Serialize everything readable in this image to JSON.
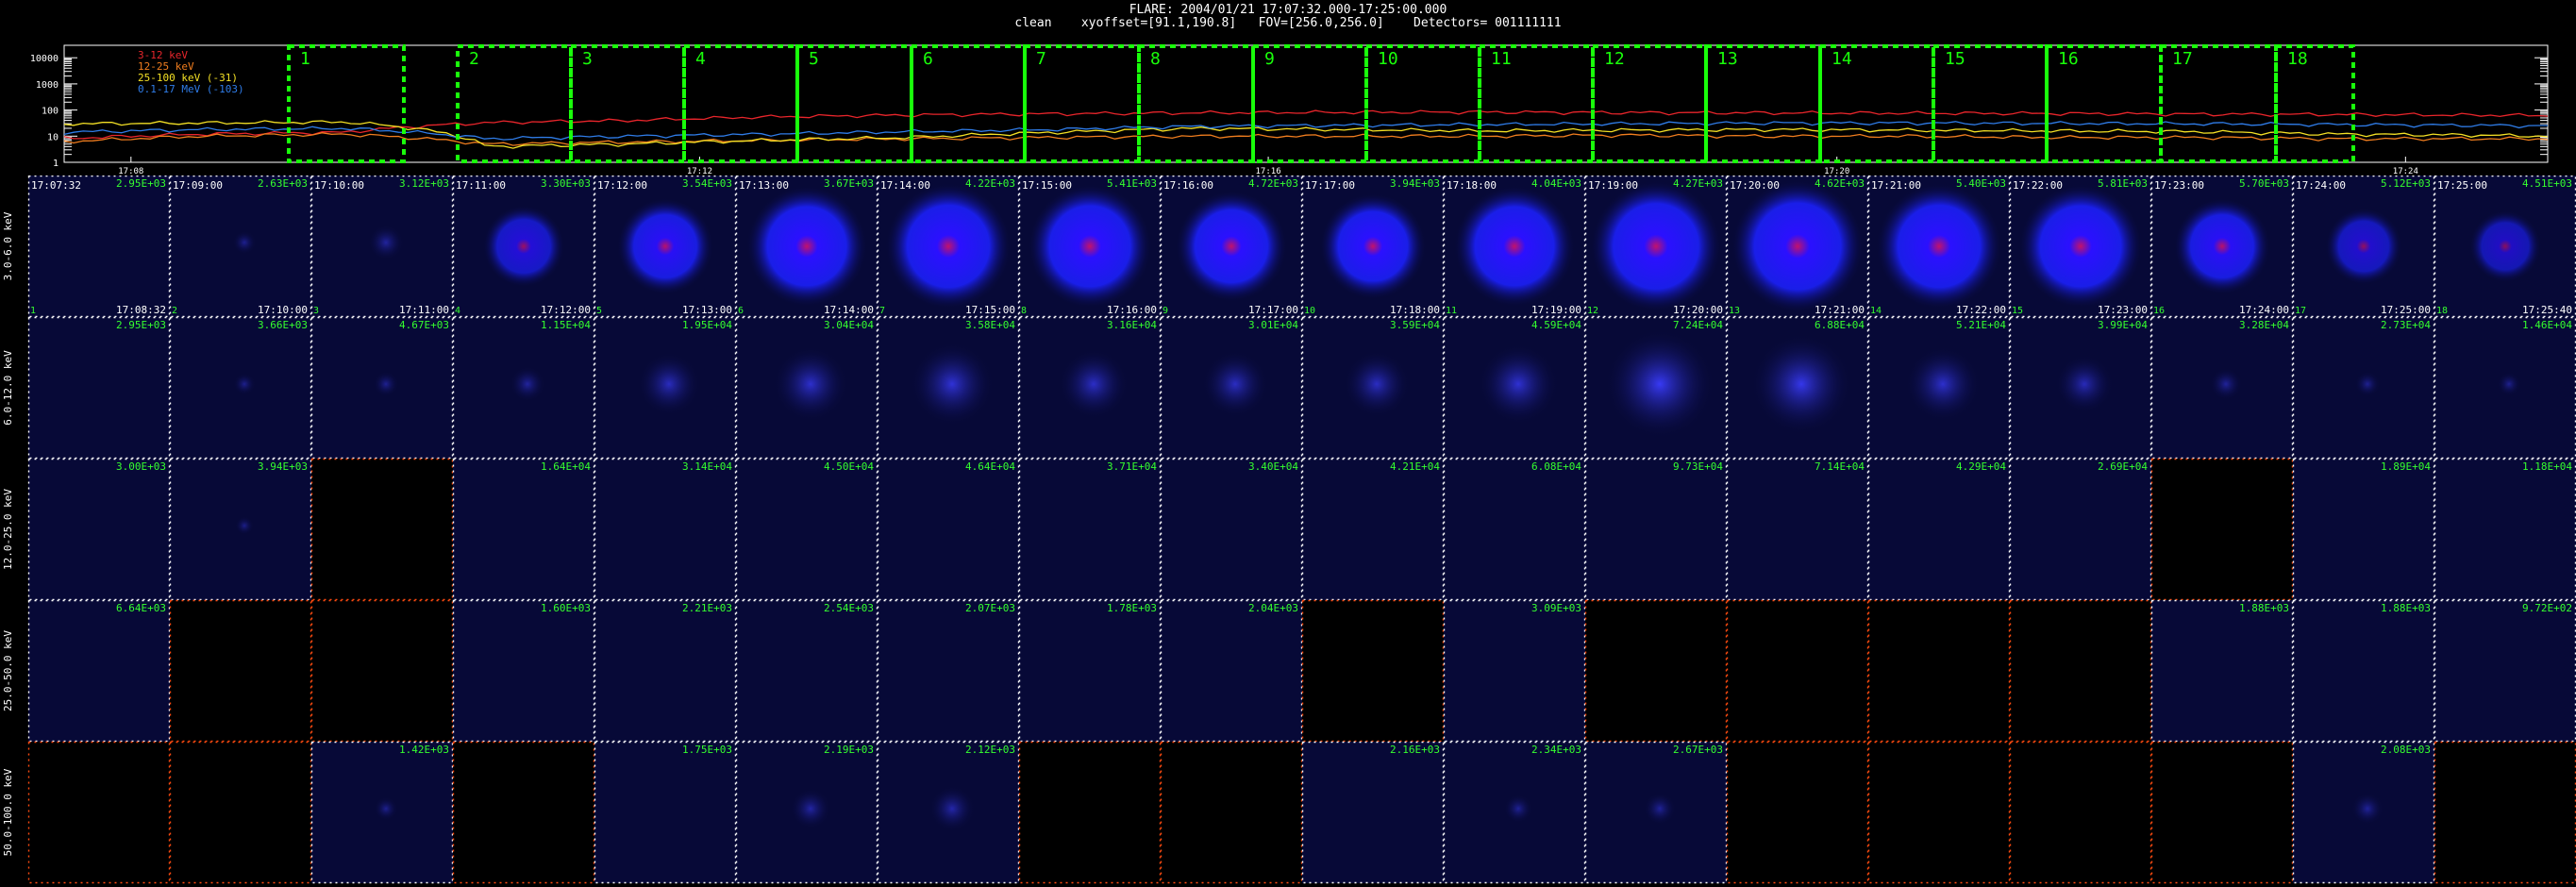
{
  "header": {
    "line1": "FLARE: 2004/01/21 17:07:32.000-17:25:00.000",
    "line2": "clean    xyoffset=[91.1,190.8]   FOV=[256.0,256.0]    Detectors= 001111111"
  },
  "chart_data": [
    {
      "type": "line",
      "title": "",
      "yscale": "log",
      "ylim": [
        1,
        30000
      ],
      "ytick_labels": [
        "1",
        "10",
        "100",
        "1000",
        "10000"
      ],
      "xlim_minutes": [
        7.53,
        25.0
      ],
      "xtick_labels": [
        "17:08",
        "17:12",
        "17:16",
        "17:20",
        "17:24"
      ],
      "legend": [
        {
          "name": "3-12 keV",
          "color": "#e8252b"
        },
        {
          "name": "12-25 keV",
          "color": "#f07d1e"
        },
        {
          "name": "25-100 keV (-31)",
          "color": "#f3e025"
        },
        {
          "name": "0.1-17 MeV (-103)",
          "color": "#2f7ce8"
        }
      ],
      "series": [
        {
          "name": "3-12 keV",
          "color": "#e8252b",
          "x": [
            7.5,
            8.5,
            9.5,
            10.5,
            11.5,
            12.5,
            13.5,
            14.5,
            15.5,
            16.5,
            17.5,
            18.5,
            19.5,
            20.5,
            21.5,
            22.5,
            23.5,
            24.5,
            25.0
          ],
          "y": [
            8,
            12,
            14,
            33,
            40,
            55,
            65,
            72,
            78,
            82,
            84,
            80,
            78,
            76,
            74,
            70,
            68,
            64,
            62
          ]
        },
        {
          "name": "12-25 keV",
          "color": "#f07d1e",
          "x": [
            7.5,
            8.5,
            9.5,
            10.5,
            11.5,
            12.5,
            13.5,
            14.5,
            15.5,
            16.5,
            17.5,
            18.5,
            19.5,
            20.5,
            21.5,
            22.5,
            23.5,
            24.5,
            25.0
          ],
          "y": [
            6,
            10,
            12,
            5,
            6,
            7,
            8,
            9,
            10,
            10,
            10,
            11,
            10,
            10,
            9,
            9,
            8,
            8,
            8
          ]
        },
        {
          "name": "25-100 keV (-31)",
          "color": "#f3e025",
          "x": [
            7.5,
            8.5,
            9.5,
            10.5,
            11.5,
            12.5,
            13.5,
            14.5,
            15.5,
            16.5,
            17.5,
            18.5,
            19.5,
            20.5,
            21.5,
            22.5,
            23.5,
            24.5,
            25.0
          ],
          "y": [
            30,
            32,
            35,
            4,
            5,
            7,
            9,
            14,
            20,
            18,
            16,
            17,
            18,
            17,
            16,
            15,
            12,
            11,
            10
          ]
        },
        {
          "name": "0.1-17 MeV (-103)",
          "color": "#2f7ce8",
          "x": [
            7.5,
            8.5,
            9.5,
            10.5,
            11.5,
            12.5,
            13.5,
            14.5,
            15.5,
            16.5,
            17.5,
            18.5,
            19.5,
            20.5,
            21.5,
            22.5,
            23.5,
            24.5,
            25.0
          ],
          "y": [
            14,
            18,
            20,
            8,
            10,
            12,
            15,
            18,
            24,
            26,
            28,
            30,
            32,
            32,
            31,
            30,
            28,
            26,
            25
          ]
        }
      ],
      "intervals": [
        "1",
        "2",
        "3",
        "4",
        "5",
        "6",
        "7",
        "8",
        "9",
        "10",
        "11",
        "12",
        "13",
        "14",
        "15",
        "16",
        "17",
        "18"
      ],
      "interval_bounds_minutes": [
        [
          9.17,
          11.17
        ],
        [
          12.13,
          14.0
        ],
        [
          14.0,
          15.9
        ],
        [
          15.9,
          17.87
        ],
        [
          17.87,
          19.87
        ],
        [
          19.87,
          21.87
        ],
        [
          21.87,
          23.87
        ],
        [
          23.87,
          25.87
        ],
        [
          25.87,
          27.87
        ],
        [
          27.87,
          29.87
        ],
        [
          29.87,
          31.87
        ],
        [
          31.87,
          33.87
        ],
        [
          33.87,
          35.87
        ],
        [
          35.87,
          37.87
        ],
        [
          37.87,
          39.87
        ],
        [
          39.87,
          41.87
        ],
        [
          41.87,
          43.87
        ],
        [
          43.87,
          45.2
        ]
      ]
    },
    {
      "type": "heatmap",
      "title": "",
      "row_labels": [
        "3.0-6.0 keV",
        "6.0-12.0 keV",
        "12.0-25.0 keV",
        "25.0-50.0 keV",
        "50.0-100.0 keV"
      ],
      "start_times": [
        "17:07:32",
        "17:09:00",
        "17:10:00",
        "17:11:00",
        "17:12:00",
        "17:13:00",
        "17:14:00",
        "17:15:00",
        "17:16:00",
        "17:17:00",
        "17:18:00",
        "17:19:00",
        "17:20:00",
        "17:21:00",
        "17:22:00",
        "17:23:00",
        "17:24:00",
        "17:25:00"
      ],
      "end_times": [
        "17:08:32",
        "17:10:00",
        "17:11:00",
        "17:12:00",
        "17:13:00",
        "17:14:00",
        "17:15:00",
        "17:16:00",
        "17:17:00",
        "17:18:00",
        "17:19:00",
        "17:20:00",
        "17:21:00",
        "17:22:00",
        "17:23:00",
        "17:24:00",
        "17:25:00",
        "17:25:40"
      ],
      "panel_numbers": [
        "1",
        "2",
        "3",
        "4",
        "5",
        "6",
        "7",
        "8",
        "9",
        "10",
        "11",
        "12",
        "13",
        "14",
        "15",
        "16",
        "17",
        "18"
      ],
      "max_labels": [
        [
          "2.95E+03",
          "2.63E+03",
          "3.12E+03",
          "3.30E+03",
          "3.54E+03",
          "3.67E+03",
          "4.22E+03",
          "5.41E+03",
          "4.72E+03",
          "3.94E+03",
          "4.04E+03",
          "4.27E+03",
          "4.62E+03",
          "5.40E+03",
          "5.81E+03",
          "5.70E+03",
          "5.12E+03",
          "4.51E+03"
        ],
        [
          "2.95E+03",
          "3.66E+03",
          "4.67E+03",
          "1.15E+04",
          "1.95E+04",
          "3.04E+04",
          "3.58E+04",
          "3.16E+04",
          "3.01E+04",
          "3.59E+04",
          "4.59E+04",
          "7.24E+04",
          "6.88E+04",
          "5.21E+04",
          "3.99E+04",
          "3.28E+04",
          "2.73E+04",
          "1.46E+04"
        ],
        [
          "3.00E+03",
          "3.94E+03",
          "",
          "1.64E+04",
          "3.14E+04",
          "4.50E+04",
          "4.64E+04",
          "3.71E+04",
          "3.40E+04",
          "4.21E+04",
          "6.08E+04",
          "9.73E+04",
          "7.14E+04",
          "4.29E+04",
          "2.69E+04",
          "",
          "1.89E+04",
          "1.18E+04"
        ],
        [
          "6.64E+03",
          "",
          "",
          "1.60E+03",
          "2.21E+03",
          "2.54E+03",
          "2.07E+03",
          "1.78E+03",
          "2.04E+03",
          "",
          "3.09E+03",
          "",
          "",
          "",
          "",
          "1.88E+03",
          "1.88E+03",
          "9.72E+02"
        ],
        [
          "",
          "",
          "1.42E+03",
          "",
          "1.75E+03",
          "2.19E+03",
          "2.12E+03",
          "",
          "",
          "2.16E+03",
          "2.34E+03",
          "2.67E+03",
          "",
          "",
          "",
          "",
          "2.08E+03",
          ""
        ]
      ],
      "black_panels": [
        [],
        [],
        [
          2,
          15
        ],
        [
          1,
          2,
          9,
          11,
          12,
          13,
          14
        ],
        [
          0,
          1,
          3,
          7,
          8,
          12,
          13,
          14,
          15,
          17
        ]
      ],
      "blob_intensity": [
        [
          0,
          0.05,
          0.12,
          0.45,
          0.6,
          0.85,
          0.9,
          0.88,
          0.75,
          0.7,
          0.85,
          0.95,
          0.97,
          0.9,
          0.88,
          0.6,
          0.4,
          0.35
        ],
        [
          0,
          0.04,
          0.06,
          0.12,
          0.28,
          0.35,
          0.4,
          0.32,
          0.3,
          0.3,
          0.38,
          0.55,
          0.5,
          0.35,
          0.25,
          0.1,
          0.06,
          0.05
        ],
        [
          0,
          0.02,
          0,
          0,
          0,
          0,
          0,
          0,
          0,
          0,
          0,
          0,
          0,
          0,
          0,
          0,
          0,
          0
        ],
        [
          0,
          0,
          0,
          0,
          0,
          0,
          0,
          0,
          0,
          0,
          0,
          0,
          0,
          0,
          0,
          0,
          0,
          0
        ],
        [
          0,
          0,
          0.05,
          0,
          0,
          0.15,
          0.18,
          0.12,
          0,
          0,
          0.08,
          0.1,
          0.1,
          0,
          0,
          0,
          0.1,
          0
        ]
      ],
      "colors": {
        "panel_bg": "#070937",
        "label_green": "#35ff2f",
        "dot_white": "#ffffff",
        "dot_orange": "#ff4b10",
        "interval_box": "#19ff0a"
      }
    }
  ]
}
